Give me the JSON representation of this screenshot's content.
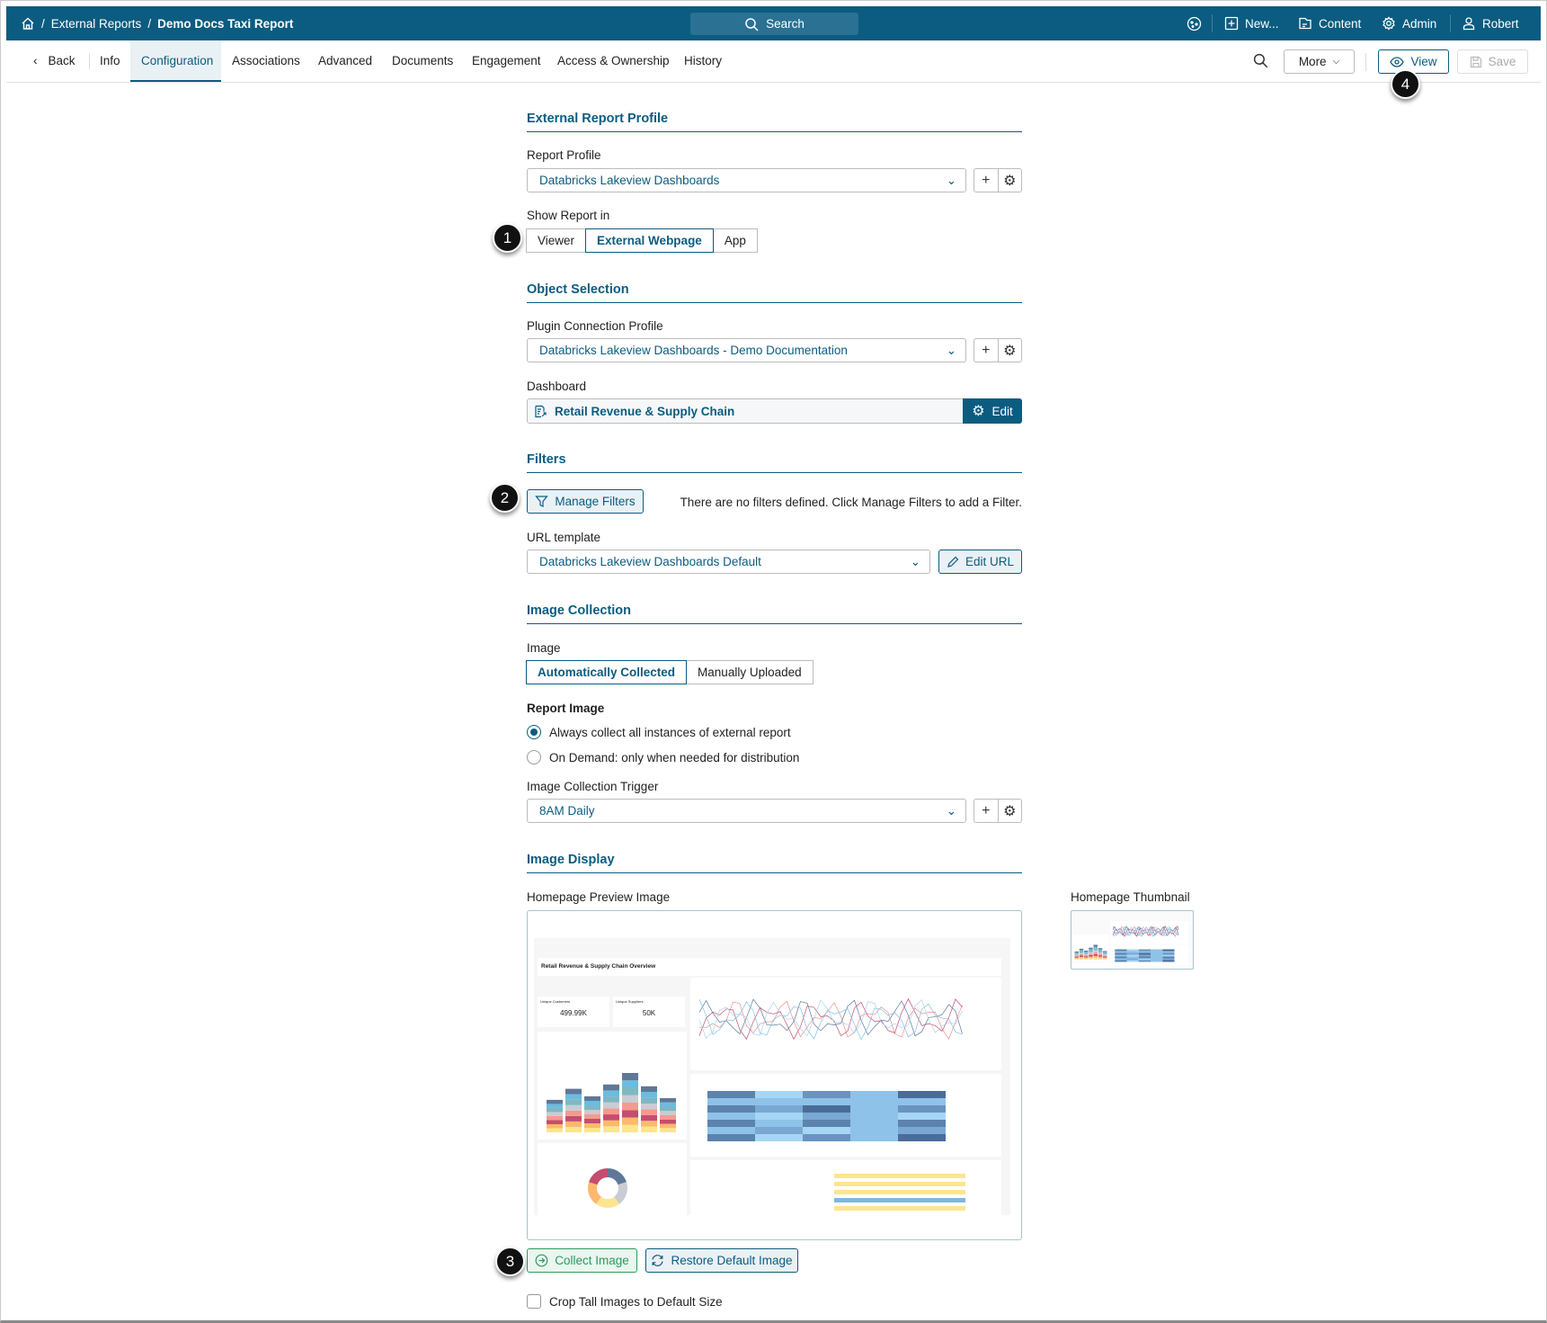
{
  "topbar": {
    "breadcrumb": [
      "External Reports",
      "Demo Docs Taxi Report"
    ],
    "search_label": "Search",
    "new_label": "New...",
    "content_label": "Content",
    "admin_label": "Admin",
    "user_label": "Robert"
  },
  "tabs": {
    "back": "Back",
    "items": [
      "Info",
      "Configuration",
      "Associations",
      "Advanced",
      "Documents",
      "Engagement",
      "Access & Ownership",
      "History"
    ],
    "active": "Configuration",
    "more_label": "More",
    "view_label": "View",
    "save_label": "Save"
  },
  "sections": {
    "profile": {
      "title": "External Report Profile",
      "report_profile_label": "Report Profile",
      "report_profile_value": "Databricks Lakeview Dashboards",
      "show_in_label": "Show Report in",
      "show_in_options": [
        "Viewer",
        "External Webpage",
        "App"
      ],
      "show_in_selected": "External Webpage"
    },
    "object": {
      "title": "Object Selection",
      "plugin_label": "Plugin Connection Profile",
      "plugin_value": "Databricks Lakeview Dashboards - Demo Documentation",
      "dashboard_label": "Dashboard",
      "dashboard_value": "Retail Revenue & Supply Chain",
      "edit_label": "Edit"
    },
    "filters": {
      "title": "Filters",
      "manage_label": "Manage Filters",
      "empty_text": "There are no filters defined. Click Manage Filters to add a Filter.",
      "url_label": "URL template",
      "url_value": "Databricks Lakeview Dashboards Default",
      "edit_url_label": "Edit URL"
    },
    "collection": {
      "title": "Image Collection",
      "image_label": "Image",
      "image_options": [
        "Automatically Collected",
        "Manually Uploaded"
      ],
      "image_selected": "Automatically Collected",
      "report_image_label": "Report Image",
      "radio_options": [
        "Always collect all instances of external report",
        "On Demand: only when needed for distribution"
      ],
      "radio_selected": 0,
      "trigger_label": "Image Collection Trigger",
      "trigger_value": "8AM Daily"
    },
    "display": {
      "title": "Image Display",
      "preview_label": "Homepage Preview Image",
      "thumbnail_label": "Homepage Thumbnail",
      "collect_label": "Collect Image",
      "restore_label": "Restore Default Image",
      "crop_label": "Crop Tall Images to Default Size",
      "crop_checked": false
    }
  },
  "preview": {
    "title": "Retail Revenue & Supply Chain Overview",
    "kpi1_label": "Unique Customers",
    "kpi1_value": "499.99K",
    "kpi2_label": "Unique Suppliers",
    "kpi2_value": "50K"
  },
  "callouts": [
    "1",
    "2",
    "3",
    "4"
  ],
  "colors": {
    "primary": "#0b5c80",
    "green": "#2e9a5e"
  }
}
